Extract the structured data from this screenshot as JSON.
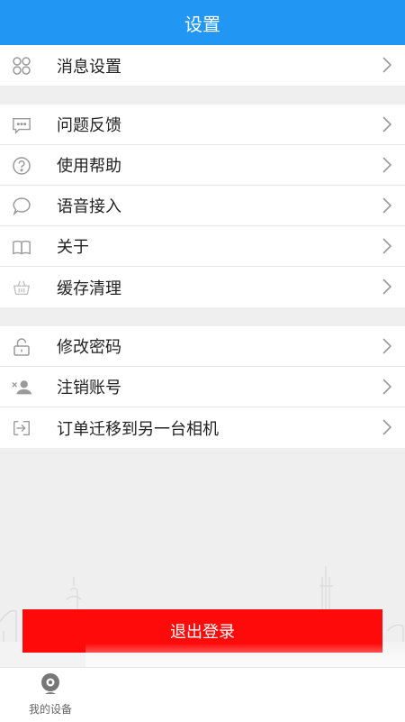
{
  "header": {
    "title": "设置"
  },
  "group1": [
    {
      "label": "消息设置",
      "icon": "grid-icon"
    }
  ],
  "group2": [
    {
      "label": "问题反馈",
      "icon": "feedback-chat-icon"
    },
    {
      "label": "使用帮助",
      "icon": "help-icon"
    },
    {
      "label": "语音接入",
      "icon": "speech-bubble-icon"
    },
    {
      "label": "关于",
      "icon": "book-icon"
    },
    {
      "label": "缓存清理",
      "icon": "basket-icon"
    }
  ],
  "group3": [
    {
      "label": "修改密码",
      "icon": "unlock-icon"
    },
    {
      "label": "注销账号",
      "icon": "remove-user-icon"
    },
    {
      "label": "订单迁移到另一台相机",
      "icon": "transfer-icon"
    }
  ],
  "logout_label": "退出登录",
  "tabbar": {
    "devices_label": "我的设备"
  },
  "colors": {
    "header": "#2196f3",
    "logout": "#ff0a0a",
    "background": "#efefef"
  }
}
